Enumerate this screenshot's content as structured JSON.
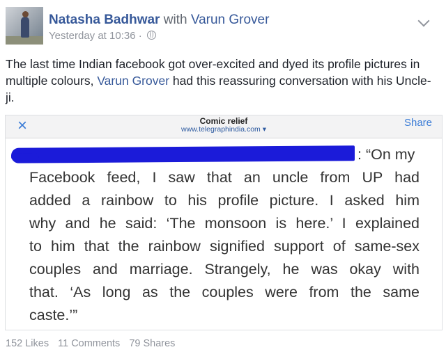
{
  "post": {
    "author": "Natasha Badhwar",
    "with_word": "with",
    "tagged": "Varun Grover",
    "timestamp": "Yesterday at 10:36",
    "dot": "·",
    "text_before_link": "The last time Indian facebook got over-excited and dyed its profile pictures in multiple colours, ",
    "text_link": "Varun Grover",
    "text_after_link": " had this reassuring conversation with his Uncle-ji."
  },
  "card": {
    "close_glyph": "×",
    "title": "Comic relief",
    "url": "www.telegraphindia.com ▾",
    "share_label": "Share",
    "quote_lines": [
      ": “On my",
      "Facebook feed, I saw that an uncle from UP had",
      "added a rainbow to his profile picture. I asked him",
      "why and he said: ‘The monsoon is here.’ I explained",
      "to him that the rainbow signified support of same-sex",
      "couples and marriage. Strangely, he was okay with",
      "that. ‘As long as the couples were from the same",
      "caste.’”"
    ],
    "redaction_color": "#1b1bd9"
  },
  "stats": {
    "likes": "152 Likes",
    "comments": "11 Comments",
    "shares": "79 Shares"
  },
  "colors": {
    "link": "#365899",
    "ios_blue": "#3b7cd6",
    "meta_gray": "#90949c"
  }
}
